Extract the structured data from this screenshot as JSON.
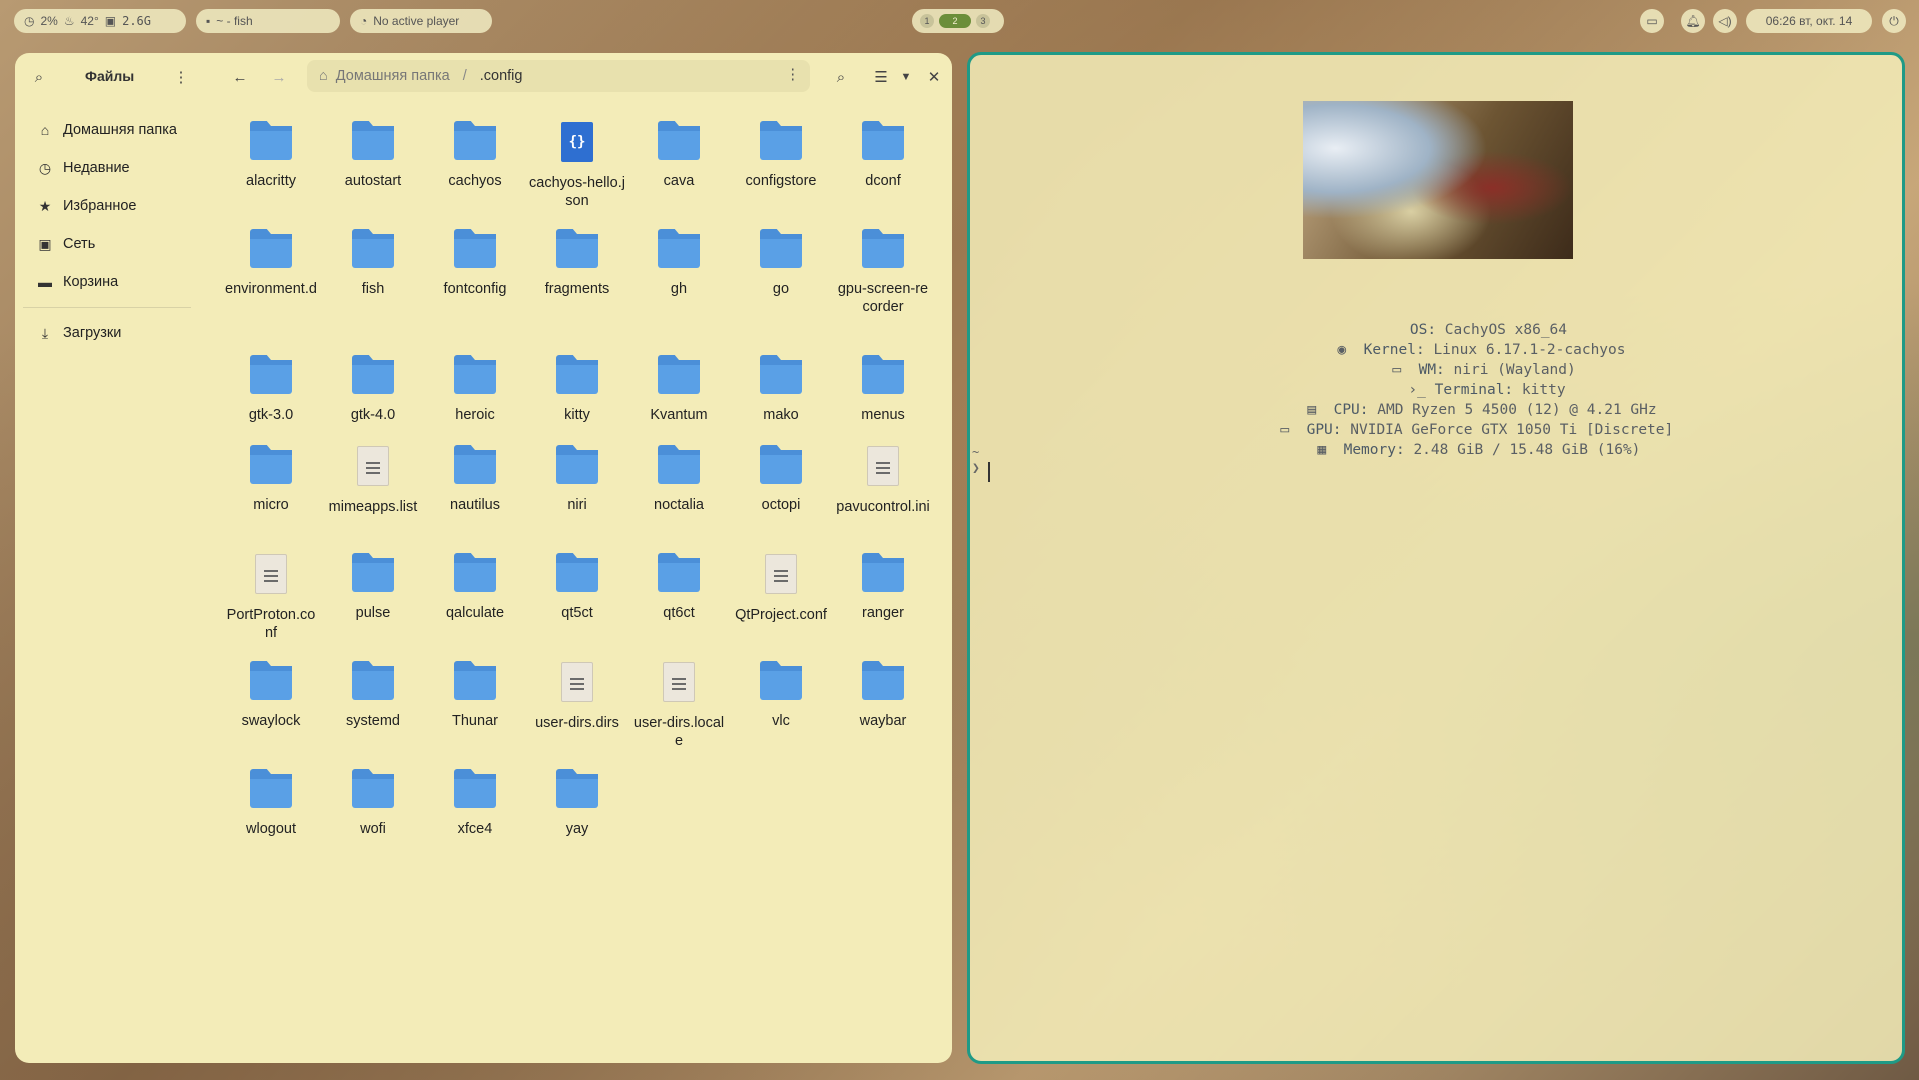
{
  "topbar": {
    "cpu": "2%",
    "temp": "42°",
    "mem": "2.6G",
    "window_title": "~ - fish",
    "player": "No active player",
    "workspaces": [
      "1",
      "2",
      "3"
    ],
    "active_workspace": "2",
    "clock": "06:26 вт, окт. 14"
  },
  "fm": {
    "title": "Файлы",
    "sidebar": [
      {
        "label": "Домашняя папка",
        "icon": "home-icon"
      },
      {
        "label": "Недавние",
        "icon": "clock-icon"
      },
      {
        "label": "Избранное",
        "icon": "star-icon"
      },
      {
        "label": "Сеть",
        "icon": "network-icon"
      },
      {
        "label": "Корзина",
        "icon": "trash-icon"
      },
      {
        "label": "Загрузки",
        "icon": "download-icon"
      }
    ],
    "path": {
      "home": "Домашняя папка",
      "current": ".config"
    },
    "files": [
      {
        "name": "alacritty",
        "kind": "folder"
      },
      {
        "name": "autostart",
        "kind": "folder"
      },
      {
        "name": "cachyos",
        "kind": "folder"
      },
      {
        "name": "cachyos-hello.json",
        "kind": "json"
      },
      {
        "name": "cava",
        "kind": "folder"
      },
      {
        "name": "configstore",
        "kind": "folder"
      },
      {
        "name": "dconf",
        "kind": "folder"
      },
      {
        "name": "environment.d",
        "kind": "folder"
      },
      {
        "name": "fish",
        "kind": "folder"
      },
      {
        "name": "fontconfig",
        "kind": "folder"
      },
      {
        "name": "fragments",
        "kind": "folder"
      },
      {
        "name": "gh",
        "kind": "folder"
      },
      {
        "name": "go",
        "kind": "folder"
      },
      {
        "name": "gpu-screen-recorder",
        "kind": "folder"
      },
      {
        "name": "gtk-3.0",
        "kind": "folder"
      },
      {
        "name": "gtk-4.0",
        "kind": "folder"
      },
      {
        "name": "heroic",
        "kind": "folder"
      },
      {
        "name": "kitty",
        "kind": "folder"
      },
      {
        "name": "Kvantum",
        "kind": "folder"
      },
      {
        "name": "mako",
        "kind": "folder"
      },
      {
        "name": "menus",
        "kind": "folder"
      },
      {
        "name": "micro",
        "kind": "folder"
      },
      {
        "name": "mimeapps.list",
        "kind": "text"
      },
      {
        "name": "nautilus",
        "kind": "folder"
      },
      {
        "name": "niri",
        "kind": "folder"
      },
      {
        "name": "noctalia",
        "kind": "folder"
      },
      {
        "name": "octopi",
        "kind": "folder"
      },
      {
        "name": "pavucontrol.ini",
        "kind": "text"
      },
      {
        "name": "PortProton.conf",
        "kind": "text"
      },
      {
        "name": "pulse",
        "kind": "folder"
      },
      {
        "name": "qalculate",
        "kind": "folder"
      },
      {
        "name": "qt5ct",
        "kind": "folder"
      },
      {
        "name": "qt6ct",
        "kind": "folder"
      },
      {
        "name": "QtProject.conf",
        "kind": "text"
      },
      {
        "name": "ranger",
        "kind": "folder"
      },
      {
        "name": "swaylock",
        "kind": "folder"
      },
      {
        "name": "systemd",
        "kind": "folder"
      },
      {
        "name": "Thunar",
        "kind": "folder"
      },
      {
        "name": "user-dirs.dirs",
        "kind": "text"
      },
      {
        "name": "user-dirs.locale",
        "kind": "text"
      },
      {
        "name": "vlc",
        "kind": "folder"
      },
      {
        "name": "waybar",
        "kind": "folder"
      },
      {
        "name": "wlogout",
        "kind": "folder"
      },
      {
        "name": "wofi",
        "kind": "folder"
      },
      {
        "name": "xfce4",
        "kind": "folder"
      },
      {
        "name": "yay",
        "kind": "folder"
      }
    ]
  },
  "terminal": {
    "fastfetch": [
      {
        "icon": "",
        "key": "OS:",
        "value": "CachyOS x86_64"
      },
      {
        "icon": "◉",
        "key": "Kernel:",
        "value": "Linux 6.17.1-2-cachyos"
      },
      {
        "icon": "▭",
        "key": "WM:",
        "value": "niri (Wayland)"
      },
      {
        "icon": "›_",
        "key": "Terminal:",
        "value": "kitty"
      },
      {
        "icon": "▤",
        "key": "CPU:",
        "value": "AMD Ryzen 5 4500 (12) @ 4.21 GHz"
      },
      {
        "icon": "▭",
        "key": "GPU:",
        "value": "NVIDIA GeForce GTX 1050 Ti [Discrete]"
      },
      {
        "icon": "▦",
        "key": "Memory:",
        "value": "2.48 GiB / 15.48 GiB (16%)"
      }
    ],
    "cwd": "~",
    "prompt": "❯"
  }
}
